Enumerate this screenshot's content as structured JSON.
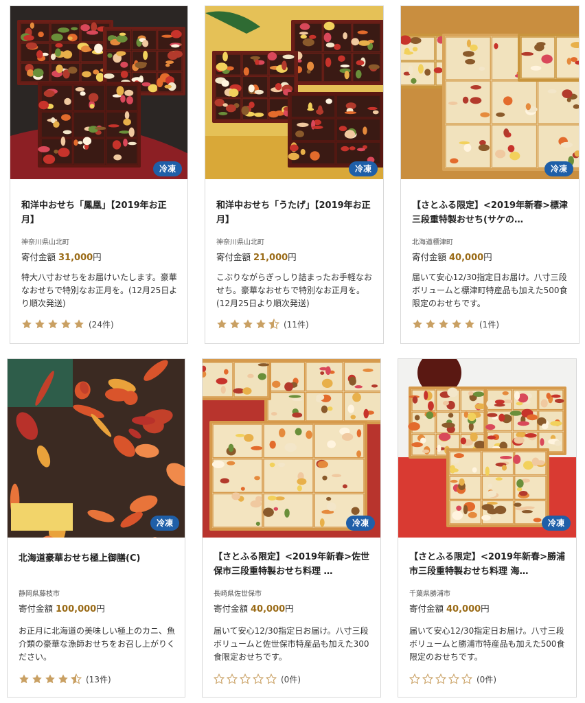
{
  "products": [
    {
      "title": "和洋中おせち「鳳凰」【2019年お正月】",
      "municipality": "神奈川県山北町",
      "price_label": "寄付金額",
      "price_amount": "31,000",
      "price_unit": "円",
      "description": "特大八寸おせちをお届けいたします。豪華なおせちで特別なお正月を。(12月25日より順次発送)",
      "badge": "冷凍",
      "rating": 5,
      "review_count": "(24件)",
      "photo_style": "dark-lacquer"
    },
    {
      "title": "和洋中おせち「うたげ」【2019年お正月】",
      "municipality": "神奈川県山北町",
      "price_label": "寄付金額",
      "price_amount": "21,000",
      "price_unit": "円",
      "description": "こぶりながらぎっしり詰まったお手軽なおせち。豪華なおせちで特別なお正月を。(12月25日より順次発送)",
      "badge": "冷凍",
      "rating": 4.5,
      "review_count": "(11件)",
      "photo_style": "gold-table"
    },
    {
      "title": "【さとふる限定】<2019年新春>標津三段重特製おせち(サケの…",
      "municipality": "北海道標津町",
      "price_label": "寄付金額",
      "price_amount": "40,000",
      "price_unit": "円",
      "description": "届いて安心12/30指定日お届け。八寸三段ボリュームと標津町特産品も加えた500食限定のおせちです。",
      "badge": "冷凍",
      "rating": 5,
      "review_count": "(1件)",
      "photo_style": "wooden-close"
    },
    {
      "title": "北海道豪華おせち極上御膳(C)",
      "municipality": "静岡県藤枝市",
      "price_label": "寄付金額",
      "price_amount": "100,000",
      "price_unit": "円",
      "description": "お正月に北海道の美味しい極上のカニ、魚介類の豪華な漁師おせちをお召し上がりください。",
      "badge": "冷凍",
      "rating": 4.5,
      "review_count": "(13件)",
      "photo_style": "crab-seafood"
    },
    {
      "title": "【さとふる限定】<2019年新春>佐世保市三段重特製おせち料理 …",
      "municipality": "長崎県佐世保市",
      "price_label": "寄付金額",
      "price_amount": "40,000",
      "price_unit": "円",
      "description": "届いて安心12/30指定日お届け。八寸三段ボリュームと佐世保市特産品も加えた300食限定おせちです。",
      "badge": "冷凍",
      "rating": 0,
      "review_count": "(0件)",
      "photo_style": "wooden-red"
    },
    {
      "title": "【さとふる限定】<2019年新春>勝浦市三段重特製おせち料理 海…",
      "municipality": "千葉県勝浦市",
      "price_label": "寄付金額",
      "price_amount": "40,000",
      "price_unit": "円",
      "description": "届いて安心12/30指定日お届け。八寸三段ボリュームと勝浦市特産品も加えた500食限定のおせちです。",
      "badge": "冷凍",
      "rating": 0,
      "review_count": "(0件)",
      "photo_style": "wooden-three-tier"
    }
  ],
  "colors": {
    "badge_bg": "#1f5fa8",
    "price_amount": "#9a6b17",
    "star_filled": "#c9a063",
    "star_empty": "#c9a063",
    "card_border": "#d8d8d8"
  },
  "icons": {
    "star_filled": "star-filled-icon",
    "star_half": "star-half-icon",
    "star_empty": "star-outline-icon"
  }
}
